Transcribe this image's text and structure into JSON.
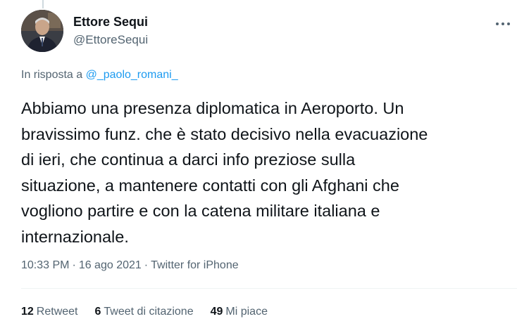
{
  "author": {
    "name": "Ettore Sequi",
    "handle": "@EttoreSequi"
  },
  "reply": {
    "prefix": "In risposta a",
    "target": "@_paolo_romani_"
  },
  "tweet": {
    "text": "Abbiamo una presenza diplomatica in Aeroporto. Un\nbravissimo funz. che è stato decisivo nella evacuazione\ndi ieri, che continua a darci info preziose sulla\nsituazione, a mantenere contatti con gli Afghani che\nvogliono partire e con la catena militare italiana e\ninternazionale.",
    "time": "10:33 PM",
    "date": "16 ago 2021",
    "source": "Twitter for iPhone"
  },
  "stats": {
    "retweets_count": "12",
    "retweets_label": "Retweet",
    "quotes_count": "6",
    "quotes_label": "Tweet di citazione",
    "likes_count": "49",
    "likes_label": "Mi piace"
  },
  "colors": {
    "accent": "#1d9bf0",
    "secondary_text": "#536471",
    "primary_text": "#0f1419"
  },
  "icons": {
    "more": "more-horizontal-icon"
  }
}
